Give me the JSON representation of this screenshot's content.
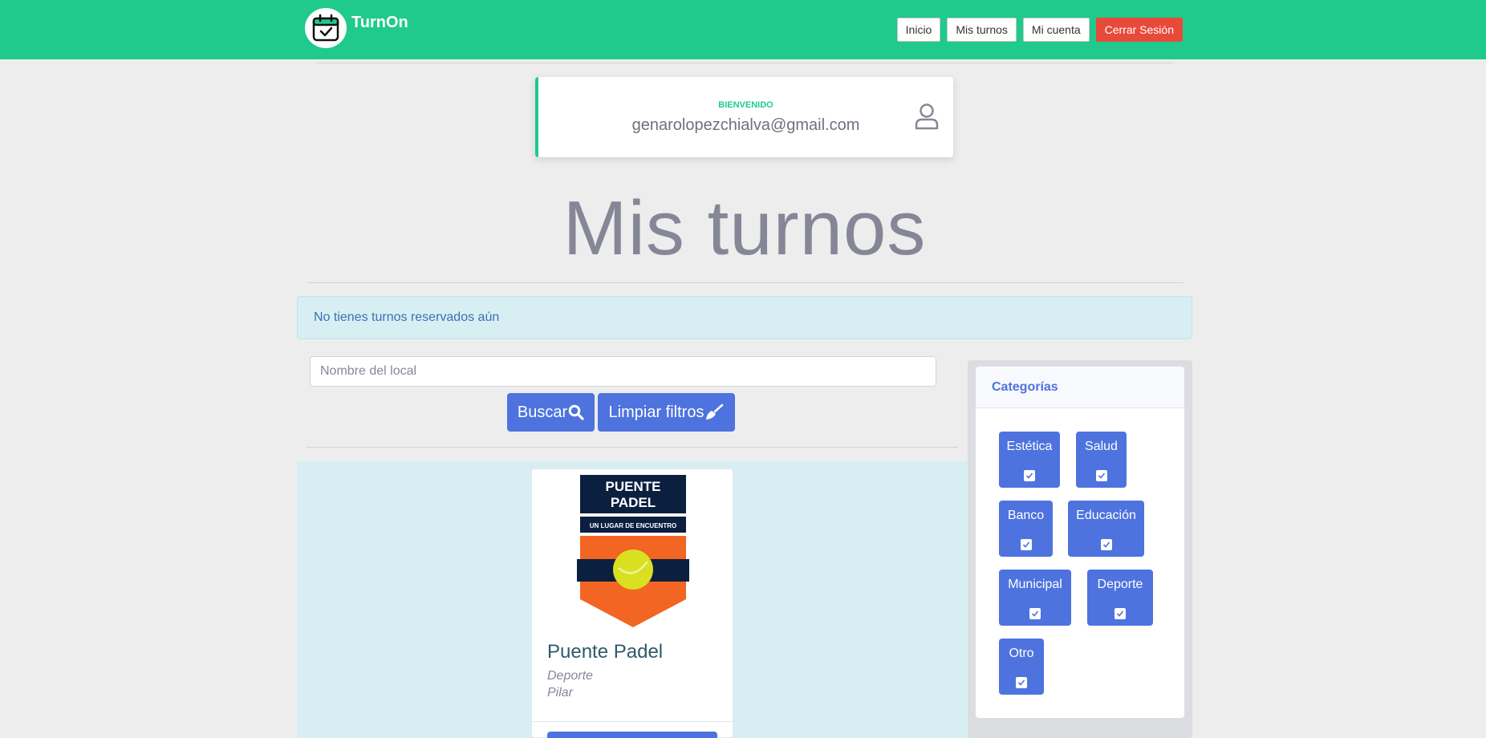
{
  "app": {
    "name": "TurnOn"
  },
  "nav": {
    "items": [
      {
        "label": "Inicio"
      },
      {
        "label": "Mis turnos"
      },
      {
        "label": "Mi cuenta"
      },
      {
        "label": "Cerrar Sesión"
      }
    ]
  },
  "welcome": {
    "label": "Bienvenido",
    "email": "genarolopezchialva@gmail.com"
  },
  "page": {
    "title": "Mis turnos"
  },
  "alert": {
    "text": "No tienes turnos reservados aún"
  },
  "search": {
    "placeholder": "Nombre del local",
    "value": "",
    "search_label": "Buscar",
    "clear_label": "Limpiar filtros"
  },
  "locales": [
    {
      "name": "Puente Padel",
      "category": "Deporte",
      "city": "Pilar",
      "logo": {
        "line1": "PUENTE",
        "line2": "PADEL",
        "tagline": "UN LUGAR DE ENCUENTRO"
      }
    }
  ],
  "categories": {
    "title": "Categorías",
    "items": [
      {
        "label": "Estética",
        "checked": true
      },
      {
        "label": "Salud",
        "checked": true
      },
      {
        "label": "Banco",
        "checked": true
      },
      {
        "label": "Educación",
        "checked": true
      },
      {
        "label": "Municipal",
        "checked": true
      },
      {
        "label": "Deporte",
        "checked": true
      },
      {
        "label": "Otro",
        "checked": true
      }
    ]
  },
  "colors": {
    "navbar": "#1fca8c",
    "primary": "#4e73df",
    "danger": "#e74a3b",
    "alert_bg": "#d7eff2",
    "page_bg": "#ededed"
  }
}
